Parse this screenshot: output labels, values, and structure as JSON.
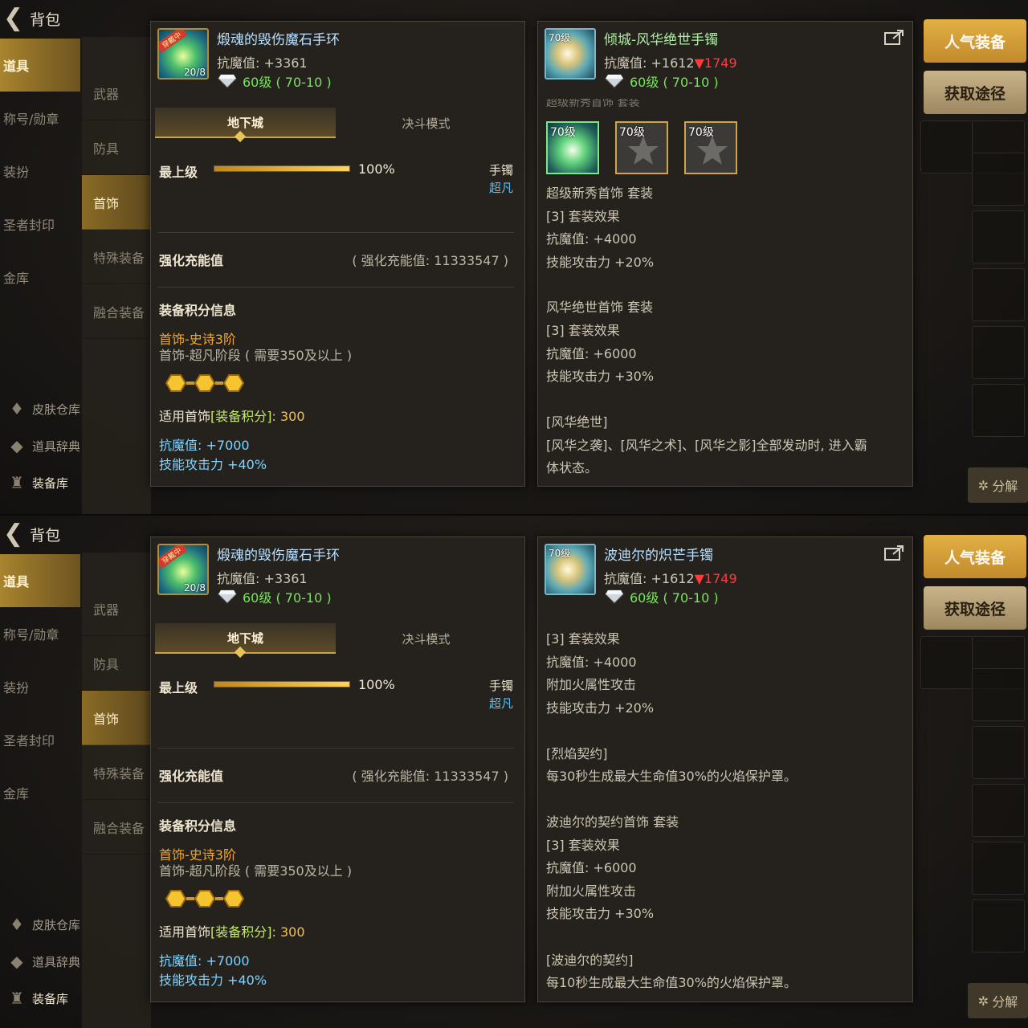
{
  "bag_title": "背包",
  "side_nav": [
    "道具",
    "称号/勋章",
    "装扮",
    "圣者封印",
    "金库"
  ],
  "side_bottom": [
    "皮肤仓库",
    "道具辞典",
    "装备库"
  ],
  "sub_nav": [
    "武器",
    "防具",
    "首饰",
    "特殊装备",
    "融合装备"
  ],
  "buttons": {
    "popular": "人气装备",
    "obtain": "获取途径",
    "dismantle": "分解"
  },
  "left_item": {
    "badge": "穿戴中",
    "icon_sub": "20/8",
    "name": "煅魂的毁伤魔石手环",
    "stat": "抗魔值: +3361",
    "level": "60级 ( 70-10 )",
    "tabs": [
      "地下城",
      "决斗模式"
    ],
    "top_label": "最上级",
    "progress": 100,
    "progress_text": "100%",
    "slot_type": "手镯",
    "slot_grade": "超凡",
    "enhance_label": "强化充能值",
    "enhance_value": "( 强化充能值: 11333547 )",
    "score_title": "装备积分信息",
    "epic_stage": "首饰-史诗3阶",
    "transcend_stage": "首饰-超凡阶段 ( 需要350及以上 )",
    "score_prefix": "适用首饰",
    "score_tag": "[装备积分]",
    "score_value": ": 300",
    "bonus_magic": "抗魔值: +7000",
    "bonus_skill": "技能攻击力 +40%"
  },
  "top_right": {
    "icon_level": "70级",
    "name": "倾城-风华绝世手镯",
    "stat_prefix": "抗魔值: +1612",
    "stat_delta": "▼1749",
    "level": "60级 ( 70-10 )",
    "cut_text": "超级新秀首饰 套装",
    "set_icons": [
      {
        "label": "70级",
        "active": true
      },
      {
        "label": "70级",
        "active": false
      },
      {
        "label": "70级",
        "active": false
      }
    ],
    "lines": [
      "超级新秀首饰 套装",
      "[3] 套装效果",
      "抗魔值: +4000",
      "技能攻击力 +20%",
      "",
      "风华绝世首饰 套装",
      "[3] 套装效果",
      "抗魔值: +6000",
      "技能攻击力 +30%",
      "",
      "[风华绝世]",
      "[风华之袭]、[风华之术]、[风华之影]全部发动时, 进入霸",
      "体状态。"
    ]
  },
  "bottom_right": {
    "icon_level": "70级",
    "name": "波迪尔的炽芒手镯",
    "stat_prefix": "抗魔值: +1612",
    "stat_delta": "▼1749",
    "level": "60级 ( 70-10 )",
    "lines": [
      "[3] 套装效果",
      "抗魔值: +4000",
      "附加火属性攻击",
      "技能攻击力 +20%",
      "",
      "[烈焰契约]",
      "每30秒生成最大生命值30%的火焰保护罩。",
      "",
      "波迪尔的契约首饰 套装",
      "[3] 套装效果",
      "抗魔值: +6000",
      "附加火属性攻击",
      "技能攻击力 +30%",
      "",
      "[波迪尔的契约]",
      "每10秒生成最大生命值30%的火焰保护罩。"
    ]
  }
}
